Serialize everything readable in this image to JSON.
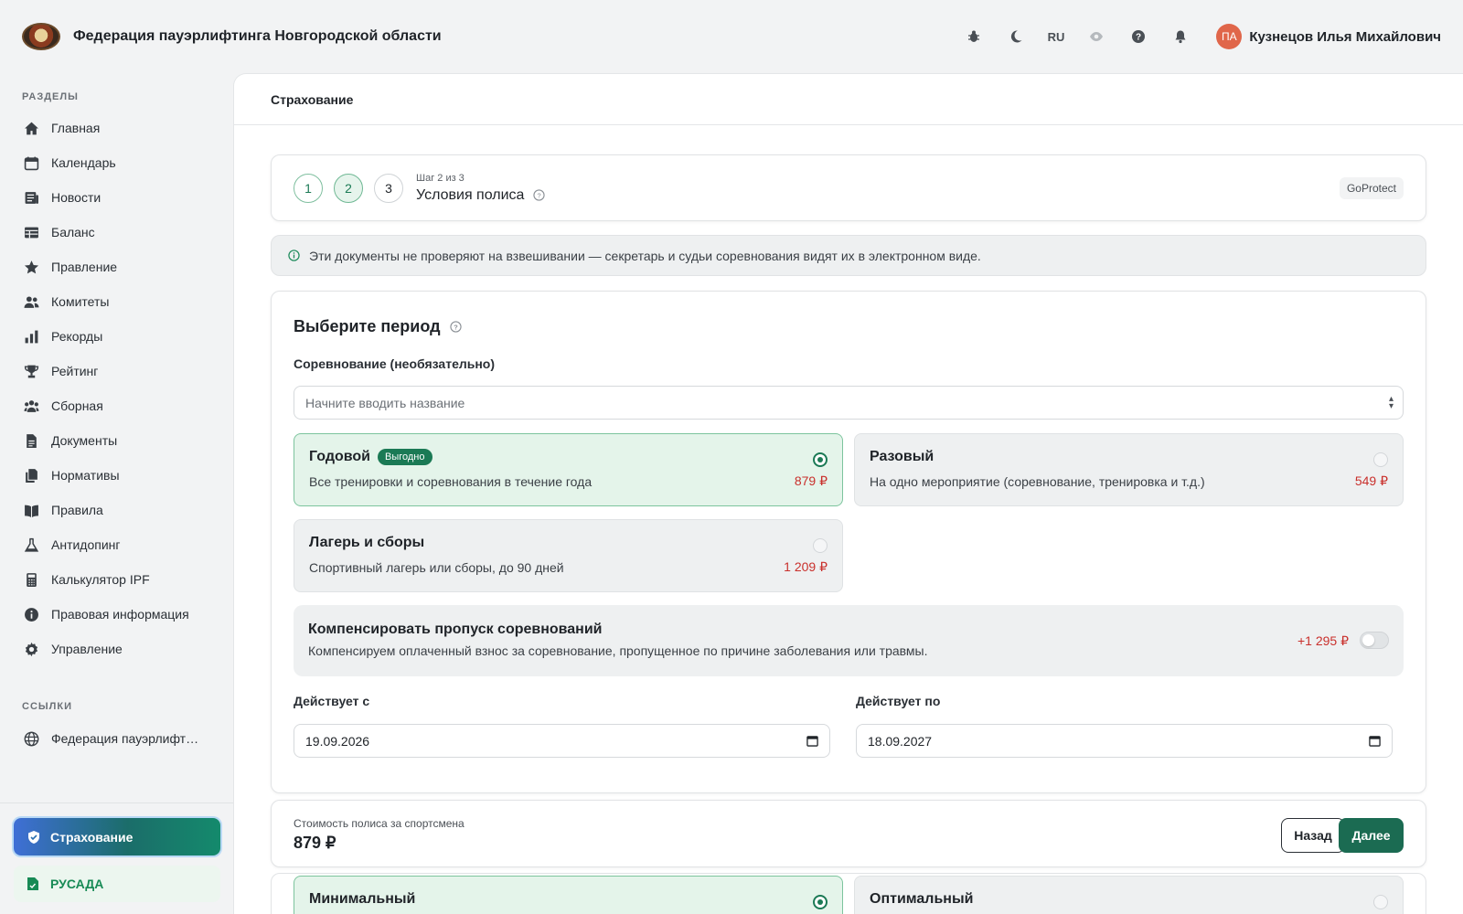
{
  "app": {
    "title": "Федерация пауэрлифтинга Новгородской области",
    "lang": "RU",
    "user_initials": "ПА",
    "user_name": "Кузнецов Илья Михайлович",
    "top_icons": [
      "bug-icon",
      "moon-icon",
      "eye-icon",
      "help-icon",
      "bell-icon"
    ]
  },
  "sidebar": {
    "sections_title": "РАЗДЕЛЫ",
    "items": [
      {
        "label": "Главная",
        "icon": "home-icon"
      },
      {
        "label": "Календарь",
        "icon": "calendar-icon"
      },
      {
        "label": "Новости",
        "icon": "news-icon"
      },
      {
        "label": "Баланс",
        "icon": "table-icon"
      },
      {
        "label": "Правление",
        "icon": "star-icon"
      },
      {
        "label": "Комитеты",
        "icon": "users-icon"
      },
      {
        "label": "Рекорды",
        "icon": "bar-chart-icon"
      },
      {
        "label": "Рейтинг",
        "icon": "trophy-icon"
      },
      {
        "label": "Сборная",
        "icon": "team-icon"
      },
      {
        "label": "Документы",
        "icon": "document-icon"
      },
      {
        "label": "Нормативы",
        "icon": "copy-icon"
      },
      {
        "label": "Правила",
        "icon": "book-icon"
      },
      {
        "label": "Антидопинг",
        "icon": "flask-icon"
      },
      {
        "label": "Калькулятор IPF",
        "icon": "calculator-icon"
      },
      {
        "label": "Правовая информация",
        "icon": "info-icon"
      },
      {
        "label": "Управление",
        "icon": "gear-icon"
      }
    ],
    "links_title": "ССЫЛКИ",
    "links": [
      {
        "label": "Федерация пауэрлифт…",
        "icon": "globe-icon"
      }
    ],
    "insurance_label": "Страхование",
    "rusada_label": "РУСАДА"
  },
  "main": {
    "header": "Страхование",
    "stepper": {
      "steps": [
        "1",
        "2",
        "3"
      ],
      "current_step_text": "Шаг 2 из 3",
      "title": "Условия полиса",
      "provider": "GoProtect"
    },
    "info": "Эти документы не проверяют на взвешивании — секретарь и судьи соревнования видят их в электронном виде.",
    "period": {
      "title": "Выберите период",
      "competition_label": "Соревнование (необязательно)",
      "competition_placeholder": "Начните вводить название",
      "options": [
        {
          "title": "Годовой",
          "badge": "Выгодно",
          "desc": "Все тренировки и соревнования в течение года",
          "price": "879 ₽",
          "selected": true
        },
        {
          "title": "Разовый",
          "badge": "",
          "desc": "На одно мероприятие (соревнование, тренировка и т.д.)",
          "price": "549 ₽",
          "selected": false
        },
        {
          "title": "Лагерь и сборы",
          "badge": "",
          "desc": "Спортивный лагерь или сборы, до 90 дней",
          "price": "1 209 ₽",
          "selected": false
        }
      ],
      "compensation": {
        "title": "Компенсировать пропуск соревнований",
        "desc": "Компенсируем оплаченный взнос за соревнование, пропущенное по причине заболевания или травмы.",
        "price": "+1 295 ₽",
        "enabled": false
      },
      "valid_from_label": "Действует с",
      "valid_from": "19.09.2026",
      "valid_to_label": "Действует по",
      "valid_to": "18.09.2027"
    },
    "footer": {
      "cost_label": "Стоимость полиса за спортсмена",
      "cost_value": "879 ₽",
      "back_label": "Назад",
      "next_label": "Далее"
    },
    "coverage": {
      "options": [
        {
          "title": "Минимальный",
          "selected": true
        },
        {
          "title": "Оптимальный",
          "selected": false
        }
      ]
    }
  },
  "colors": {
    "accent": "#1b6b52",
    "price": "#c9302c",
    "selected_bg": "#e4f4ea"
  }
}
